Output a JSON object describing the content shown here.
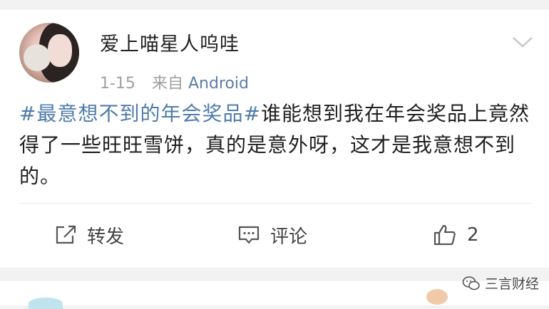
{
  "post": {
    "username": "爱上喵星人呜哇",
    "date": "1-15",
    "source_label": "来自",
    "source_app": "Android",
    "hashtag": "#最意想不到的年会奖品#",
    "text": "谁能想到我在年会奖品上竟然得了一些旺旺雪饼，真的是意外呀，这才是我意想不到的。"
  },
  "actions": {
    "repost_label": "转发",
    "comment_label": "评论",
    "like_count": "2"
  },
  "watermark": {
    "text": "三言财经"
  },
  "colors": {
    "link": "#4f7cab",
    "meta": "#a0a0a0",
    "background": "#f2f2f2"
  },
  "icons": [
    "chevron-down-icon",
    "repost-icon",
    "comment-icon",
    "thumbs-up-icon",
    "wechat-icon"
  ]
}
